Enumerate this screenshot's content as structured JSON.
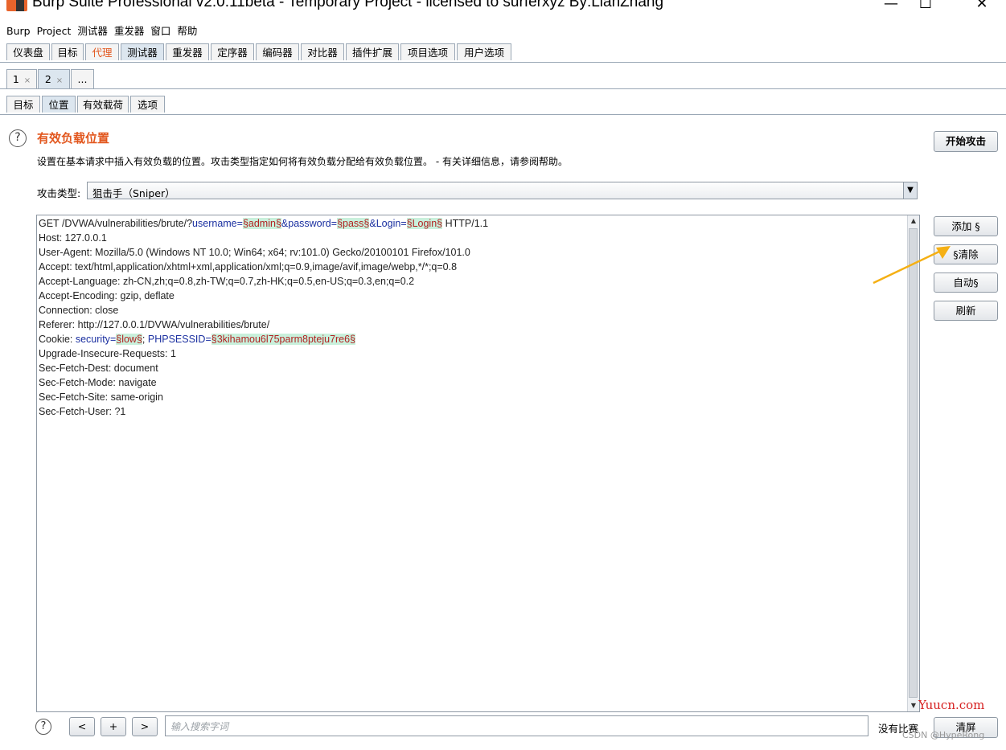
{
  "window": {
    "title": "Burp Suite Professional v2.0.11beta - Temporary Project - licensed to surferxyz By:LianZhang",
    "minimize": "—",
    "maximize": "☐",
    "close": "✕"
  },
  "menu": [
    "Burp",
    "Project",
    "测试器",
    "重发器",
    "窗口",
    "帮助"
  ],
  "main_tabs": [
    "仪表盘",
    "目标",
    "代理",
    "测试器",
    "重发器",
    "定序器",
    "编码器",
    "对比器",
    "插件扩展",
    "项目选项",
    "用户选项"
  ],
  "session_tabs": [
    {
      "label": "1",
      "close": "×"
    },
    {
      "label": "2",
      "close": "×"
    },
    {
      "label": "...",
      "close": ""
    }
  ],
  "sub_tabs": [
    "目标",
    "位置",
    "有效载荷",
    "选项"
  ],
  "positions": {
    "help_glyph": "?",
    "heading": "有效负载位置",
    "description": "设置在基本请求中插入有效负载的位置。攻击类型指定如何将有效负载分配给有效负载位置。 - 有关详细信息，请参阅帮助。",
    "start_attack": "开始攻击",
    "attack_type_label": "攻击类型:",
    "attack_type_value": "狙击手（Sniper）",
    "buttons": {
      "add": "添加 §",
      "clear": "§清除",
      "auto": "自动§",
      "refresh": "刷新"
    }
  },
  "request": {
    "l1_a": "GET /DVWA/vulnerabilities/brute/?",
    "l1_k1": "username",
    "l1_eq1": "=",
    "l1_p1": "§admin§",
    "l1_amp1": "&",
    "l1_k2": "password",
    "l1_eq2": "=",
    "l1_p2": "§pass§",
    "l1_amp2": "&",
    "l1_k3": "Login",
    "l1_eq3": "=",
    "l1_p3": "§Login§",
    "l1_end": " HTTP/1.1",
    "l2": "Host: 127.0.0.1",
    "l3": "User-Agent: Mozilla/5.0 (Windows NT 10.0; Win64; x64; rv:101.0) Gecko/20100101 Firefox/101.0",
    "l4": "Accept: text/html,application/xhtml+xml,application/xml;q=0.9,image/avif,image/webp,*/*;q=0.8",
    "l5": "Accept-Language: zh-CN,zh;q=0.8,zh-TW;q=0.7,zh-HK;q=0.5,en-US;q=0.3,en;q=0.2",
    "l6": "Accept-Encoding: gzip, deflate",
    "l7": "Connection: close",
    "l8": "Referer: http://127.0.0.1/DVWA/vulnerabilities/brute/",
    "l9_a": "Cookie: ",
    "l9_k1": "security",
    "l9_eq1": "=",
    "l9_p1": "§low§",
    "l9_sep": "; ",
    "l9_k2": "PHPSESSID",
    "l9_eq2": "=",
    "l9_p2": "§3kihamou6l75parm8pteju7re6§",
    "l10": "Upgrade-Insecure-Requests: 1",
    "l11": "Sec-Fetch-Dest: document",
    "l12": "Sec-Fetch-Mode: navigate",
    "l13": "Sec-Fetch-Site: same-origin",
    "l14": "Sec-Fetch-User: ?1"
  },
  "search": {
    "help_glyph": "?",
    "prev": "<",
    "add": "+",
    "next": ">",
    "placeholder": "输入搜索字词",
    "no_match": "没有比赛",
    "clear": "清屏"
  },
  "scroll": {
    "up": "▲",
    "down": "▼"
  },
  "watermarks": {
    "site": "Yuucn.com",
    "credit": "CSDN @HypeRong"
  },
  "colors": {
    "accent": "#e2571e",
    "payload_bg": "#c9f0dc",
    "param_key": "#1a2fa0",
    "arrow": "#f5b014"
  }
}
